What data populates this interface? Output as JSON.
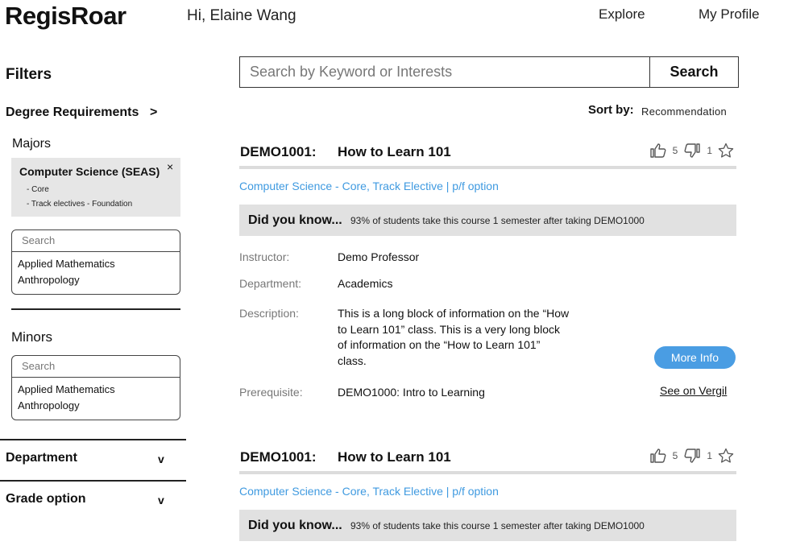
{
  "header": {
    "logo": "RegisRoar",
    "greeting": "Hi, Elaine Wang",
    "nav": {
      "explore": "Explore",
      "profile": "My Profile"
    }
  },
  "sidebar": {
    "title": "Filters",
    "degree_requirements": {
      "label": "Degree Requirements",
      "arrow": ">"
    },
    "majors": {
      "label": "Majors",
      "selected": {
        "name": "Computer Science (SEAS)",
        "close": "×",
        "sub": [
          "- Core",
          "- Track electives - Foundation"
        ]
      },
      "search_placeholder": "Search",
      "options": [
        "Applied Mathematics",
        "Anthropology"
      ]
    },
    "minors": {
      "label": "Minors",
      "search_placeholder": "Search",
      "options": [
        "Applied Mathematics",
        "Anthropology"
      ]
    },
    "department": {
      "label": "Department",
      "toggle": "v"
    },
    "grade_option": {
      "label": "Grade option",
      "toggle": "v"
    }
  },
  "search": {
    "placeholder": "Search by Keyword or Interests",
    "button": "Search"
  },
  "sort": {
    "label": "Sort by:",
    "value": "Recommendation"
  },
  "courses": [
    {
      "code": "DEMO1001:",
      "title": "How to Learn 101",
      "likes": "5",
      "dislikes": "1",
      "tags": "Computer Science - Core, Track Elective  |  p/f option",
      "dyk_label": "Did you know...",
      "dyk_text": "93% of students take this course 1 semester after taking DEMO1000",
      "fields": {
        "instructor_label": "Instructor:",
        "instructor": "Demo Professor",
        "department_label": "Department:",
        "department": "Academics",
        "description_label": "Description:",
        "description": "This is a  long block of information on the “How to Learn 101” class. This is a very long block of information on the “How to Learn 101” class.",
        "prerequisite_label": "Prerequisite:",
        "prerequisite": "DEMO1000: Intro to Learning"
      },
      "more_info": "More Info",
      "vergil": "See on Vergil"
    },
    {
      "code": "DEMO1001:",
      "title": "How to Learn 101",
      "likes": "5",
      "dislikes": "1",
      "tags": "Computer Science - Core, Track Elective  |  p/f option",
      "dyk_label": "Did you know...",
      "dyk_text": "93% of students take this course 1 semester after taking DEMO1000"
    }
  ],
  "icons": {
    "thumbs_up": "thumbs-up-icon",
    "thumbs_down": "thumbs-down-icon",
    "star": "star-icon"
  },
  "colors": {
    "accent": "#4a9de3",
    "link": "#3f9ae0",
    "panel": "#e1e1e1"
  }
}
